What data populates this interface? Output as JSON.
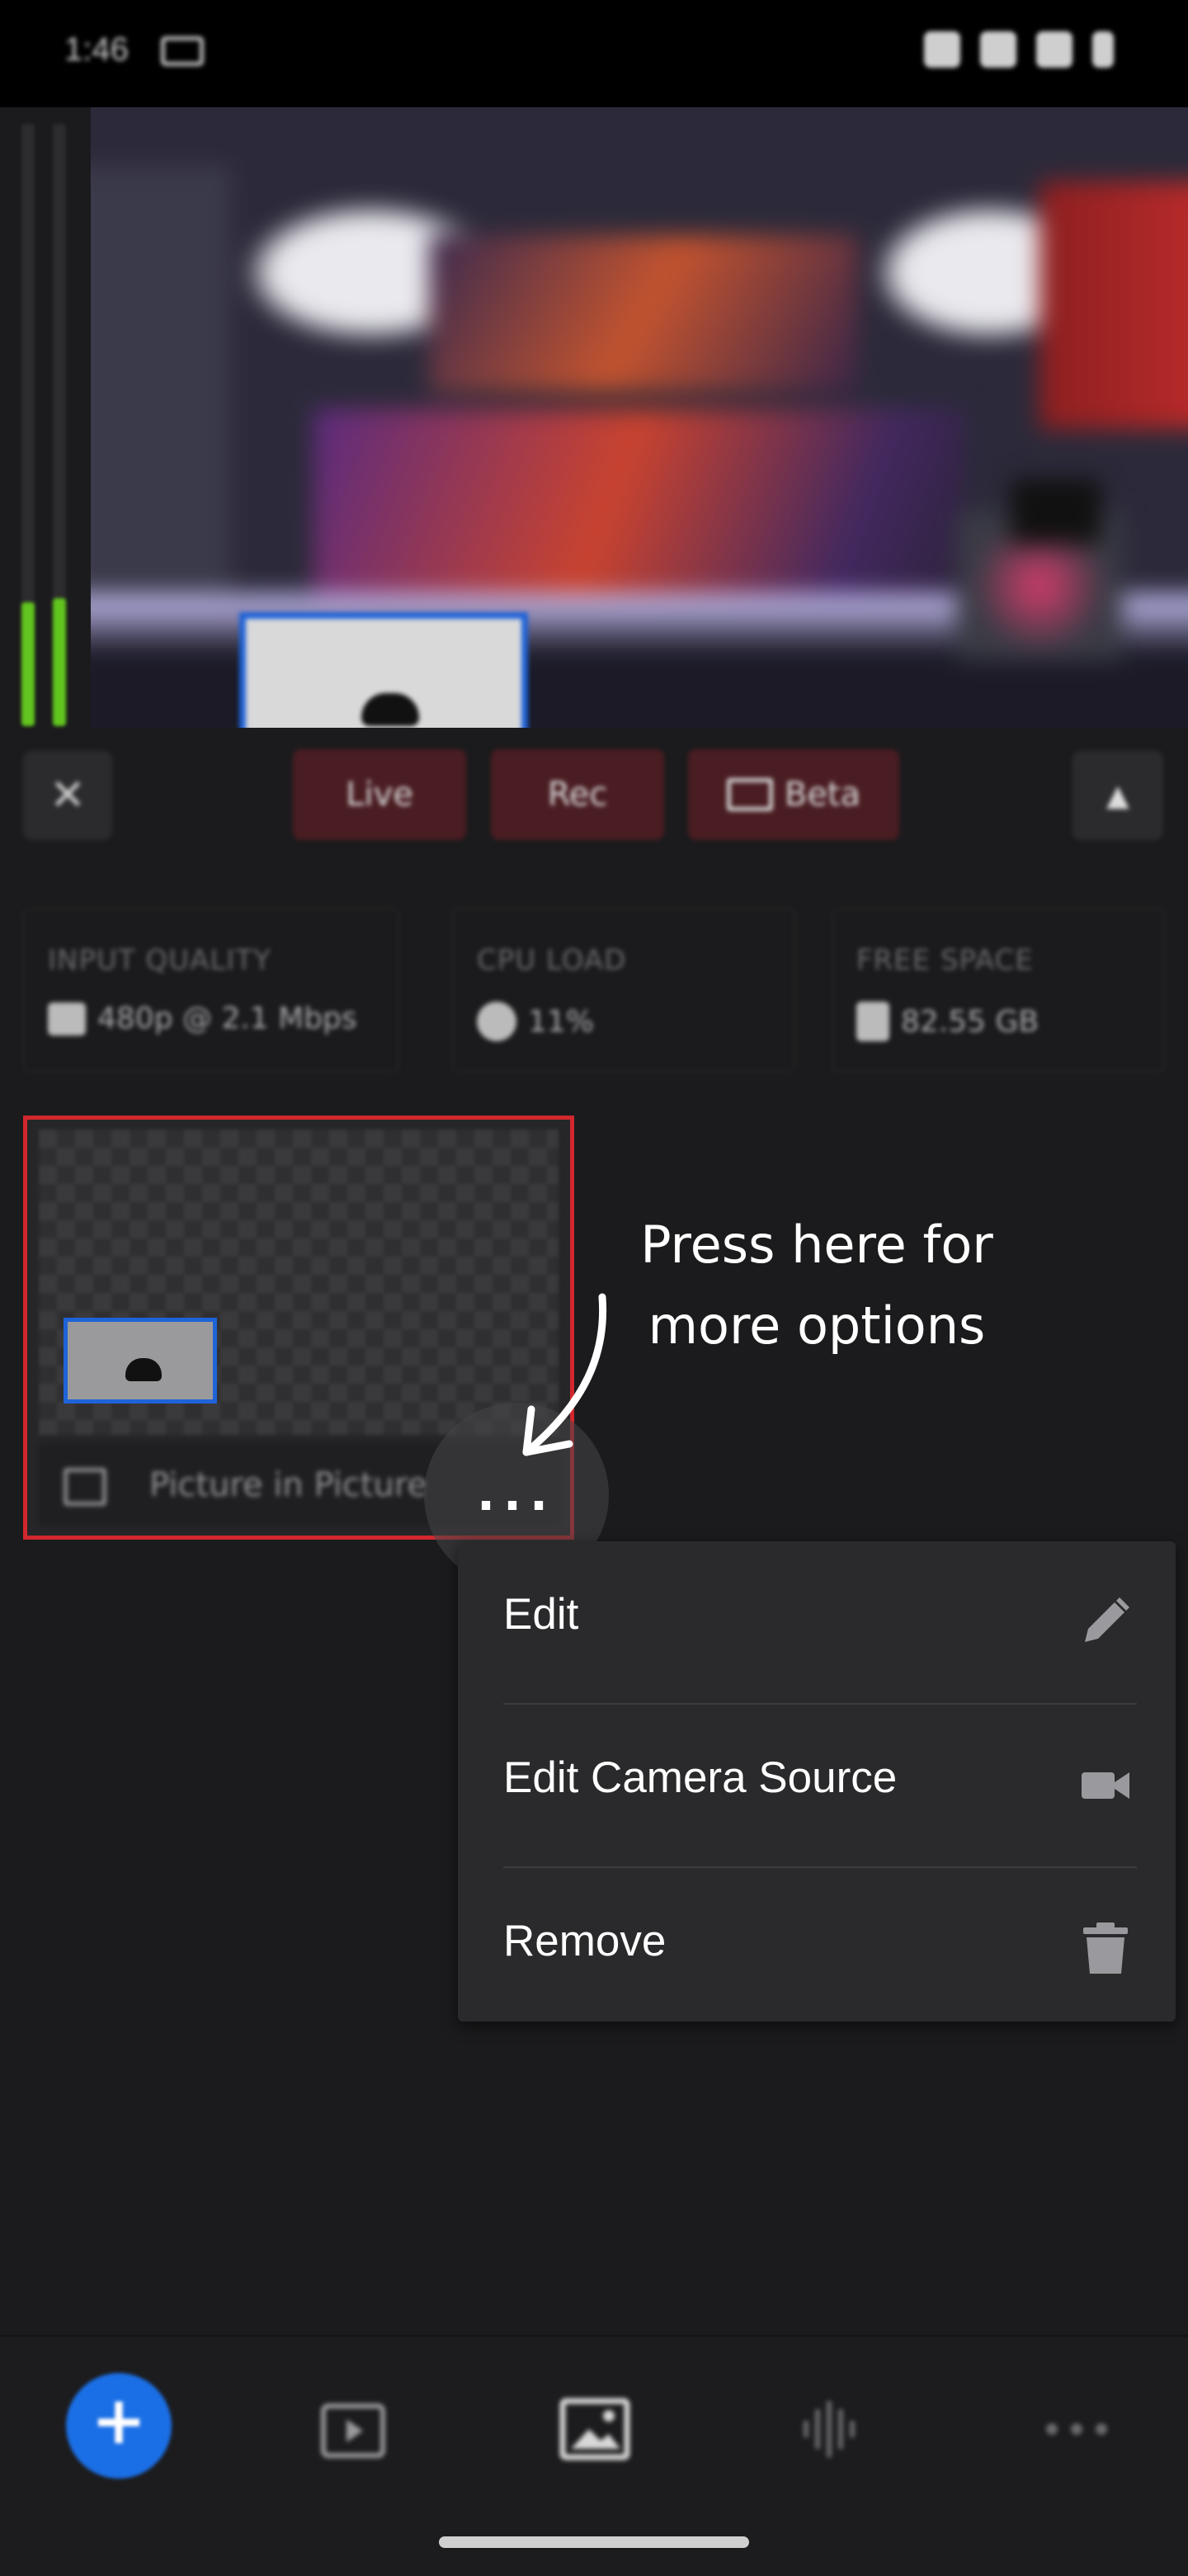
{
  "status_bar": {
    "time": "1:46"
  },
  "controls": {
    "live_label": "Live",
    "rec_label": "Rec",
    "beta_label": "Beta"
  },
  "stats": [
    {
      "label": "INPUT QUALITY",
      "value": "480p @ 2.1 Mbps",
      "icon": "video-camera-icon"
    },
    {
      "label": "CPU LOAD",
      "value": "11%",
      "icon": "cpu-icon"
    },
    {
      "label": "FREE SPACE",
      "value": "82.55 GB",
      "icon": "sd-card-icon"
    }
  ],
  "scene": {
    "name": "Picture in Picture",
    "more_label": "..."
  },
  "callout": {
    "line1": "Press here for",
    "line2": "more options"
  },
  "menu": {
    "items": [
      {
        "label": "Edit",
        "icon": "pencil-icon"
      },
      {
        "label": "Edit Camera Source",
        "icon": "video-camera-icon"
      },
      {
        "label": "Remove",
        "icon": "trash-icon"
      }
    ]
  },
  "bottom_nav": {
    "items": [
      {
        "icon": "add-icon",
        "glyph": "+"
      },
      {
        "icon": "media-play-icon"
      },
      {
        "icon": "image-overlay-icon"
      },
      {
        "icon": "audio-wave-icon"
      },
      {
        "icon": "more-icon"
      }
    ]
  },
  "colors": {
    "accent_red": "#d1272d",
    "accent_blue": "#1b6fe6",
    "meter_green": "#61c41f",
    "pill_bg": "#4a1d22"
  }
}
